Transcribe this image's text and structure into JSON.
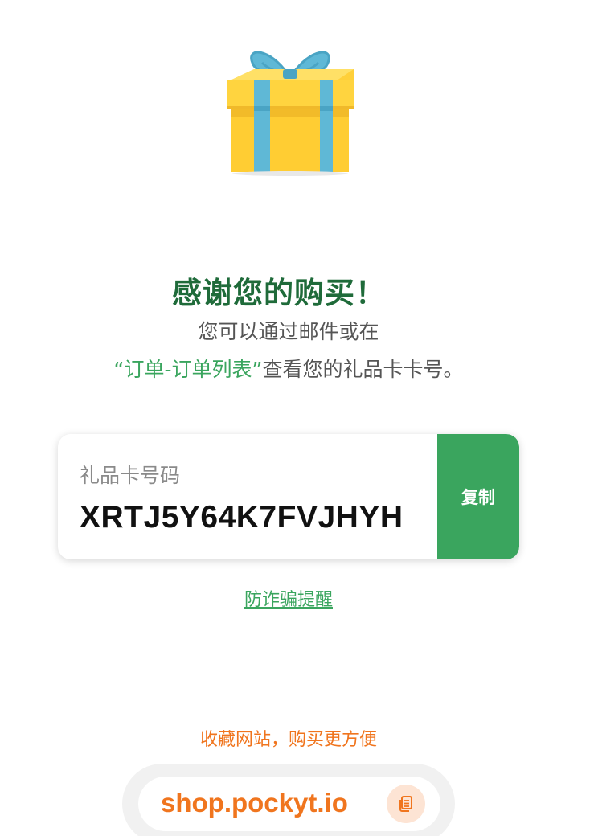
{
  "gift": {
    "icon": "gift-box-icon",
    "colors": {
      "box": "#ffd03a",
      "ribbon": "#5fb8d6"
    }
  },
  "heading": {
    "title": "感谢您的购买！",
    "line1": "您可以通过邮件或在",
    "line2_link": "“订单-订单列表”",
    "line2_rest": "查看您的礼品卡卡号。"
  },
  "card": {
    "label": "礼品卡号码",
    "code": "XRTJ5Y64K7FVJHYH",
    "copy_label": "复制"
  },
  "fraud_link": "防诈骗提醒",
  "bookmark": {
    "tip": "收藏网站，购买更方便",
    "url": "shop.pockyt.io",
    "copy_icon": "copy-icon"
  },
  "colors": {
    "brand_green": "#3aa55e",
    "title_green": "#1f6b3a",
    "orange": "#f0751e"
  }
}
